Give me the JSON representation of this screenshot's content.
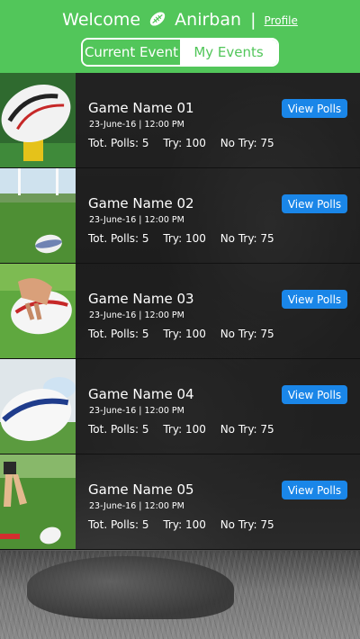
{
  "header": {
    "welcome_label": "Welcome",
    "ball_icon": "rugby-ball-icon",
    "user_name": "Anirban",
    "separator": "|",
    "profile_label": "Profile",
    "brand_color": "#52c65a"
  },
  "tabs": {
    "current_event_label": "Current Event",
    "my_events_label": "My Events",
    "active": "Current Event"
  },
  "events": [
    {
      "name": "Game Name 01",
      "datetime": "23-June-16 | 12:00 PM",
      "total_polls": "Tot. Polls: 5",
      "try": "Try: 100",
      "no_try": "No Try: 75",
      "button": "View Polls"
    },
    {
      "name": "Game Name 02",
      "datetime": "23-June-16 | 12:00 PM",
      "total_polls": "Tot. Polls: 5",
      "try": "Try: 100",
      "no_try": "No Try: 75",
      "button": "View Polls"
    },
    {
      "name": "Game Name 03",
      "datetime": "23-June-16 | 12:00 PM",
      "total_polls": "Tot. Polls: 5",
      "try": "Try: 100",
      "no_try": "No Try: 75",
      "button": "View Polls"
    },
    {
      "name": "Game Name 04",
      "datetime": "23-June-16 | 12:00 PM",
      "total_polls": "Tot. Polls: 5",
      "try": "Try: 100",
      "no_try": "No Try: 75",
      "button": "View Polls"
    },
    {
      "name": "Game Name 05",
      "datetime": "23-June-16 | 12:00 PM",
      "total_polls": "Tot. Polls: 5",
      "try": "Try: 100",
      "no_try": "No Try: 75",
      "button": "View Polls"
    }
  ],
  "colors": {
    "button_blue": "#1a86e8"
  }
}
